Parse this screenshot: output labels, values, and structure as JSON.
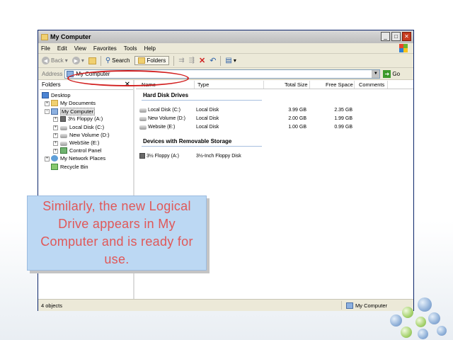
{
  "window": {
    "title": "My Computer",
    "title_icon": "folder-icon",
    "controls": {
      "minimize": "_",
      "maximize": "□",
      "close": "✕"
    }
  },
  "menu": [
    "File",
    "Edit",
    "View",
    "Favorites",
    "Tools",
    "Help"
  ],
  "toolbar": {
    "back_label": "Back",
    "search_label": "Search",
    "folders_label": "Folders"
  },
  "address": {
    "label": "Address",
    "value": "My Computer",
    "go_label": "Go"
  },
  "folders_pane": {
    "header": "Folders",
    "close": "✕",
    "items": [
      {
        "label": "Desktop",
        "icon": "desktop-icon"
      },
      {
        "label": "My Documents",
        "icon": "folder-icon"
      },
      {
        "label": "My Computer",
        "icon": "computer-icon",
        "selected": true
      },
      {
        "label": "3½ Floppy (A:)",
        "icon": "floppy-icon"
      },
      {
        "label": "Local Disk (C:)",
        "icon": "drive-icon"
      },
      {
        "label": "New Volume (D:)",
        "icon": "drive-icon"
      },
      {
        "label": "WebSite (E:)",
        "icon": "drive-icon"
      },
      {
        "label": "Control Panel",
        "icon": "control-panel-icon"
      },
      {
        "label": "My Network Places",
        "icon": "network-icon"
      },
      {
        "label": "Recycle Bin",
        "icon": "recycle-bin-icon"
      }
    ]
  },
  "columns": [
    "Name",
    "Type",
    "Total Size",
    "Free Space",
    "Comments"
  ],
  "groups": [
    {
      "title": "Hard Disk Drives",
      "rows": [
        {
          "name": "Local Disk (C:)",
          "type": "Local Disk",
          "total": "3.99 GB",
          "free": "2.35 GB"
        },
        {
          "name": "New Volume (D:)",
          "type": "Local Disk",
          "total": "2.00 GB",
          "free": "1.99 GB"
        },
        {
          "name": "Website (E:)",
          "type": "Local Disk",
          "total": "1.00 GB",
          "free": "0.99 GB"
        }
      ]
    },
    {
      "title": "Devices with Removable Storage",
      "rows": [
        {
          "name": "3½ Floppy (A:)",
          "type": "3½-Inch Floppy Disk",
          "total": "",
          "free": ""
        }
      ]
    }
  ],
  "status": {
    "left": "4 objects",
    "right": "My Computer"
  },
  "callout": {
    "text": "Similarly, the new Logical Drive appears in My Computer and is ready for use."
  },
  "colors": {
    "callout_bg": "#bcd8f3",
    "callout_text": "#e05858",
    "highlight": "#d21f1f"
  }
}
